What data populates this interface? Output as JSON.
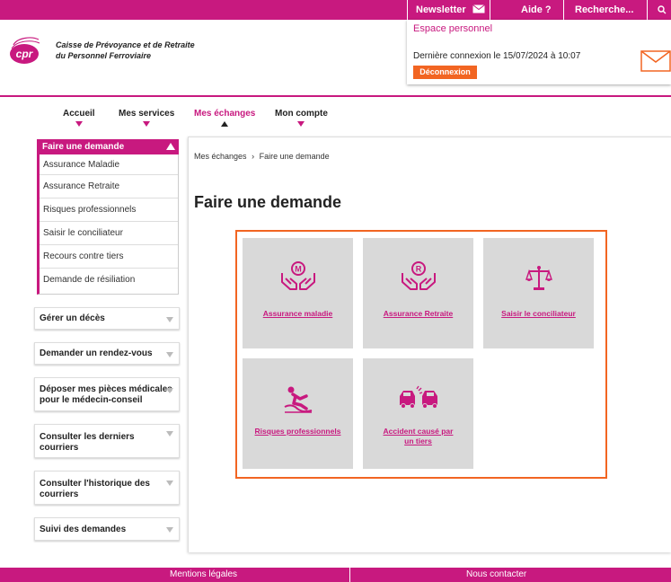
{
  "topbar": {
    "newsletter": "Newsletter",
    "help": "Aide ?",
    "search_placeholder": "Recherche..."
  },
  "espace": {
    "title": "Espace personnel",
    "last_login": "Dernière connexion le 15/07/2024 à 10:07",
    "logout": "Déconnexion"
  },
  "brand": {
    "logo_text": "cpr",
    "org_line1": "Caisse de Prévoyance et de Retraite",
    "org_line2": "du Personnel Ferroviaire"
  },
  "nav": {
    "items": [
      {
        "label": "Accueil"
      },
      {
        "label": "Mes services"
      },
      {
        "label": "Mes échanges"
      },
      {
        "label": "Mon compte"
      }
    ]
  },
  "sidebar": {
    "header": "Faire une demande",
    "items": [
      "Assurance Maladie",
      "Assurance Retraite",
      "Risques professionnels",
      "Saisir le conciliateur",
      "Recours contre tiers",
      "Demande de résiliation"
    ],
    "sections": [
      {
        "line1": "Gérer un décès",
        "line2": ""
      },
      {
        "line1": "Demander un rendez-vous",
        "line2": ""
      },
      {
        "line1": "Déposer mes pièces médicales",
        "line2": "pour le médecin-conseil"
      },
      {
        "line1": "Consulter les derniers",
        "line2": "courriers"
      },
      {
        "line1": "Consulter l'historique des",
        "line2": "courriers"
      },
      {
        "line1": "Suivi des demandes",
        "line2": ""
      }
    ]
  },
  "main": {
    "breadcrumb_root": "Mes échanges",
    "breadcrumb_sep": "›",
    "breadcrumb_current": "Faire une demande",
    "title": "Faire une demande",
    "tiles": [
      {
        "line1": "Assurance maladie",
        "line2": ""
      },
      {
        "line1": "Assurance Retraite",
        "line2": ""
      },
      {
        "line1": "Saisir le conciliateur",
        "line2": ""
      },
      {
        "line1": "Risques professionnels",
        "line2": ""
      },
      {
        "line1": "Accident causé par",
        "line2": "un tiers"
      }
    ]
  },
  "footer": {
    "legal": "Mentions légales",
    "contact": "Nous contacter"
  },
  "colors": {
    "brand": "#c8197f",
    "accent": "#f26522",
    "tile_bg": "#d9d9d9"
  }
}
